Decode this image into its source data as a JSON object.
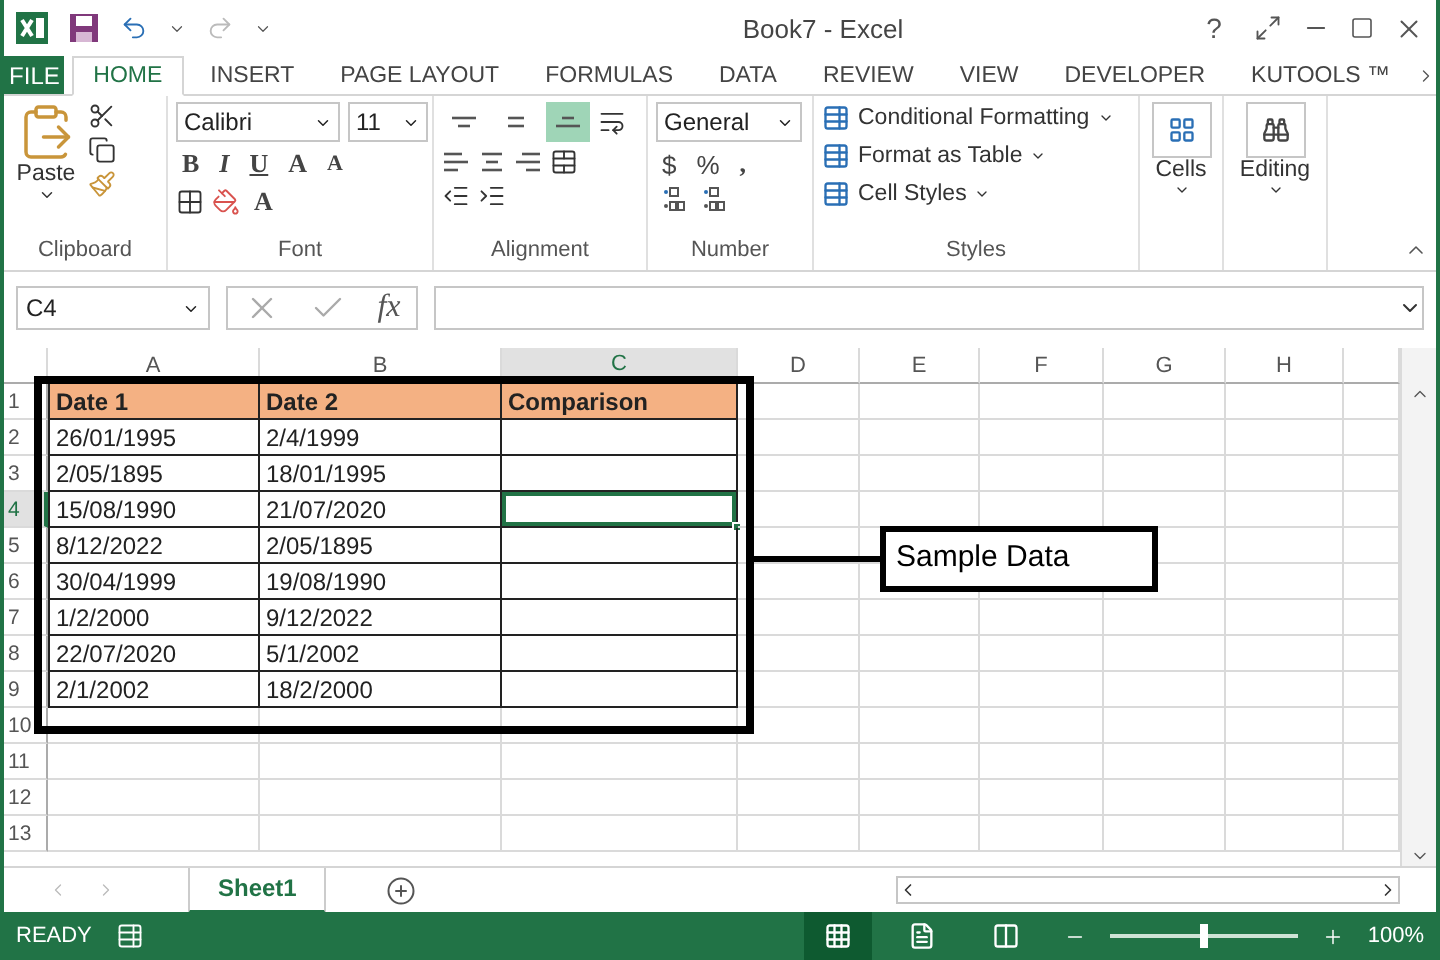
{
  "window": {
    "title": "Book7 - Excel",
    "help": "?"
  },
  "ribbon": {
    "file_tab": "FILE",
    "tabs": [
      {
        "label": "HOME",
        "selected": true
      },
      {
        "label": "INSERT",
        "selected": false
      },
      {
        "label": "PAGE LAYOUT",
        "selected": false
      },
      {
        "label": "FORMULAS",
        "selected": false
      },
      {
        "label": "DATA",
        "selected": false
      },
      {
        "label": "REVIEW",
        "selected": false
      },
      {
        "label": "VIEW",
        "selected": false
      },
      {
        "label": "DEVELOPER",
        "selected": false
      },
      {
        "label": "KUTOOLS ™",
        "selected": false
      }
    ],
    "clipboard": {
      "paste": "Paste",
      "label": "Clipboard"
    },
    "font": {
      "name": "Calibri",
      "size": "11",
      "bold": "B",
      "italic": "I",
      "underline": "U",
      "grow": "A",
      "shrink": "A",
      "font_color_button": "A",
      "label": "Font"
    },
    "alignment": {
      "vertical": [
        {
          "kind": "top",
          "selected": false
        },
        {
          "kind": "middle",
          "selected": false
        },
        {
          "kind": "bottom",
          "selected": true
        }
      ],
      "label": "Alignment"
    },
    "number": {
      "format": "General",
      "currency": "$",
      "percent": "%",
      "comma": ",",
      "label": "Number"
    },
    "styles": {
      "items": [
        "Conditional Formatting",
        "Format as Table",
        "Cell Styles"
      ],
      "label": "Styles"
    },
    "cells": "Cells",
    "editing": "Editing"
  },
  "formula_bar": {
    "name_box": "C4",
    "function_label": "fx"
  },
  "sheet": {
    "columns": [
      {
        "label": "A",
        "selected": false
      },
      {
        "label": "B",
        "selected": false
      },
      {
        "label": "C",
        "selected": true
      },
      {
        "label": "D",
        "selected": false
      },
      {
        "label": "E",
        "selected": false
      },
      {
        "label": "F",
        "selected": false
      },
      {
        "label": "G",
        "selected": false
      },
      {
        "label": "H",
        "selected": false
      }
    ],
    "rows": [
      {
        "number": "1",
        "kind": "header",
        "selected": false,
        "cells": [
          "Date 1",
          "Date 2",
          "Comparison"
        ]
      },
      {
        "number": "2",
        "kind": "data",
        "selected": false,
        "cells": [
          "26/01/1995",
          "2/4/1999"
        ]
      },
      {
        "number": "3",
        "kind": "data",
        "selected": false,
        "cells": [
          "2/05/1895",
          "18/01/1995"
        ]
      },
      {
        "number": "4",
        "kind": "data",
        "selected": true,
        "cells": [
          "15/08/1990",
          "21/07/2020"
        ]
      },
      {
        "number": "5",
        "kind": "data",
        "selected": false,
        "cells": [
          "8/12/2022",
          "2/05/1895"
        ]
      },
      {
        "number": "6",
        "kind": "data",
        "selected": false,
        "cells": [
          "30/04/1999",
          "19/08/1990"
        ]
      },
      {
        "number": "7",
        "kind": "data",
        "selected": false,
        "cells": [
          "1/2/2000",
          "9/12/2022"
        ]
      },
      {
        "number": "8",
        "kind": "data",
        "selected": false,
        "cells": [
          "22/07/2020",
          "5/1/2002"
        ]
      },
      {
        "number": "9",
        "kind": "data",
        "selected": false,
        "cells": [
          "2/1/2002",
          "18/2/2000"
        ]
      },
      {
        "number": "10",
        "kind": "empty",
        "selected": false,
        "cells": []
      },
      {
        "number": "11",
        "kind": "empty",
        "selected": false,
        "cells": []
      },
      {
        "number": "12",
        "kind": "empty",
        "selected": false,
        "cells": []
      },
      {
        "number": "13",
        "kind": "empty",
        "selected": false,
        "cells": []
      }
    ],
    "annotation": "Sample Data"
  },
  "sheet_tabs": [
    {
      "label": "Sheet1",
      "selected": true
    }
  ],
  "status_bar": {
    "status": "READY",
    "views": [
      {
        "kind": "normal",
        "selected": true
      },
      {
        "kind": "page_layout",
        "selected": false
      },
      {
        "kind": "page_break",
        "selected": false
      }
    ],
    "zoom_slider": {
      "level": 0.5
    },
    "zoom": "100%"
  }
}
